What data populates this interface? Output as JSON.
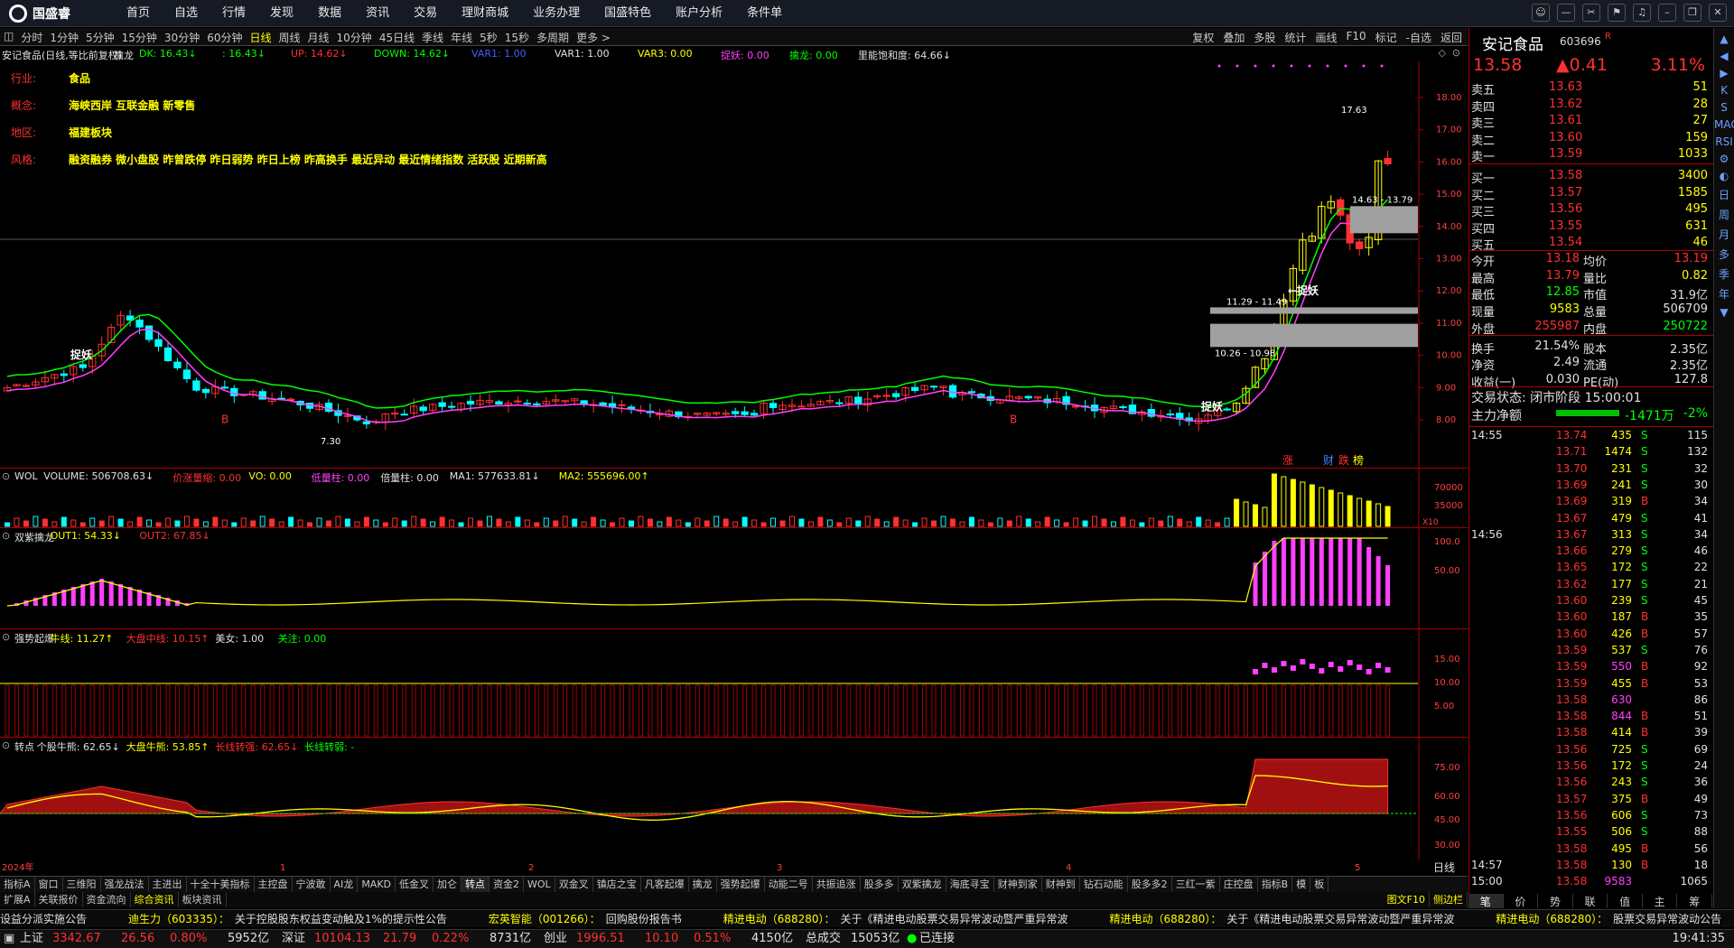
{
  "app": {
    "logo_text": "国盛睿"
  },
  "menu": [
    "首页",
    "自选",
    "行情",
    "发现",
    "数据",
    "资讯",
    "交易",
    "理财商城",
    "业务办理",
    "国盛特色",
    "账户分析",
    "条件单"
  ],
  "window_controls": [
    "chat-icon",
    "min-icon",
    "restore-icon",
    "tools-icon",
    "bell-icon",
    "min2-icon",
    "max-icon",
    "close-icon"
  ],
  "periods": [
    "分时",
    "1分钟",
    "5分钟",
    "15分钟",
    "30分钟",
    "60分钟",
    "日线",
    "周线",
    "月线",
    "10分钟",
    "45日线",
    "季线",
    "年线",
    "5秒",
    "15秒",
    "多周期",
    "更多 >"
  ],
  "period_active": "日线",
  "chart_tools": [
    "复权",
    "叠加",
    "多股",
    "统计",
    "画线",
    "F10",
    "标记",
    "-自选",
    "返回"
  ],
  "title_line": [
    {
      "t": "安记食品(日线,等比前复权)",
      "c": "#e0e0e0"
    },
    {
      "t": "擒龙",
      "c": "#e0e0e0"
    },
    {
      "t": "DK: 16.43↓",
      "c": "#00ff00"
    },
    {
      "t": ": 16.43↓",
      "c": "#00ff00"
    },
    {
      "t": "UP: 14.62↓",
      "c": "#ff3030"
    },
    {
      "t": "DOWN: 14.62↓",
      "c": "#00ff00"
    },
    {
      "t": "VAR1: 1.00",
      "c": "#4060ff"
    },
    {
      "t": "VAR1: 1.00",
      "c": "#e0e0e0"
    },
    {
      "t": "VAR3: 0.00",
      "c": "#ffff00"
    },
    {
      "t": "捉妖: 0.00",
      "c": "#ff40ff"
    },
    {
      "t": "擒龙: 0.00",
      "c": "#00ff00"
    },
    {
      "t": "里能饱和度: 64.66↓",
      "c": "#e0e0e0"
    }
  ],
  "info": [
    {
      "k": "行业:",
      "v": "食品"
    },
    {
      "k": "概念:",
      "v": "海峡西岸 互联金融 新零售"
    },
    {
      "k": "地区:",
      "v": "福建板块"
    },
    {
      "k": "风格:",
      "v": "融资融券 微小盘股 昨曾跌停 昨日弱势 昨日上榜 昨高换手 最近异动 最近情绪指数 活跃股 近期新高"
    }
  ],
  "annotations": {
    "high": "17.63",
    "box1": "14.63 - 13.79",
    "box2": "11.29 - 11.49",
    "box3": "10.26 - 10.98",
    "zhuoyao": "捉妖",
    "zhuoyao_arrow": "←捉妖",
    "low": "7.30",
    "b": "B",
    "marks": [
      "涨",
      "财",
      "跌",
      "榜"
    ]
  },
  "sub_headers": {
    "vol": [
      {
        "t": "WOL",
        "c": "#e0e0e0"
      },
      {
        "t": "VOLUME: 506708.63↓",
        "c": "#e0e0e0"
      },
      {
        "t": "价涨量缩: 0.00",
        "c": "#ff3030"
      },
      {
        "t": "VO: 0.00",
        "c": "#ffff00"
      },
      {
        "t": "低量柱: 0.00",
        "c": "#ff40ff"
      },
      {
        "t": "倍量柱: 0.00",
        "c": "#e0e0e0"
      },
      {
        "t": "MA1: 577633.81↓",
        "c": "#e0e0e0"
      },
      {
        "t": "MA2: 555696.00↑",
        "c": "#ffff00"
      }
    ],
    "sz": [
      {
        "t": "双紫擒龙",
        "c": "#e0e0e0"
      },
      {
        "t": "OUT1: 54.33↓",
        "c": "#ffff00"
      },
      {
        "t": "OUT2: 67.85↓",
        "c": "#ff3030"
      }
    ],
    "qs": [
      {
        "t": "强势起爆",
        "c": "#e0e0e0"
      },
      {
        "t": "牛线: 11.27↑",
        "c": "#ffff00"
      },
      {
        "t": "大盘中线: 10.15↑",
        "c": "#ff3030"
      },
      {
        "t": "美女: 1.00",
        "c": "#e0e0e0"
      },
      {
        "t": "关注: 0.00",
        "c": "#00ff00"
      }
    ],
    "zd": [
      {
        "t": "转点",
        "c": "#e0e0e0"
      },
      {
        "t": "个股牛熊: 62.65↓",
        "c": "#e0e0e0"
      },
      {
        "t": "大盘牛熊: 53.85↑",
        "c": "#ffff00"
      },
      {
        "t": "长线转强: 62.65↓",
        "c": "#ff3030"
      },
      {
        "t": "长线转弱: -",
        "c": "#00ff00"
      }
    ]
  },
  "main_axis": [
    "18.00",
    "17.00",
    "16.00",
    "15.00",
    "14.00",
    "13.00",
    "12.00",
    "11.00",
    "10.00",
    "9.00",
    "8.00"
  ],
  "vol_axis": [
    "70000",
    "35000"
  ],
  "vol_unit": "X10",
  "sz_axis": [
    "100.0",
    "50.00"
  ],
  "qs_axis": [
    "15.00",
    "10.00",
    "5.00"
  ],
  "zd_axis": [
    "75.00",
    "60.00",
    "45.00",
    "30.00"
  ],
  "x_labels": [
    "2024年",
    "1",
    "2",
    "3",
    "4",
    "5"
  ],
  "period_label": "日线",
  "bottom_tabs": [
    "指标A",
    "窗口",
    "三维阳",
    "强龙战法",
    "主进出",
    "十全十美指标",
    "主控盘",
    "宁波敢",
    "AI龙",
    "MAKD",
    "低金叉",
    "加仑",
    "转点",
    "资金2",
    "WOL",
    "双金叉",
    "镇店之宝",
    "凡客起爆",
    "擒龙",
    "强势起爆",
    "动能二号",
    "共振追涨",
    "股多多",
    "双紫擒龙",
    "海底寻宝",
    "财神到家",
    "财神到",
    "钻石动能",
    "股多多2",
    "三红一紫",
    "庄控盘",
    "指标B",
    "模",
    "板"
  ],
  "bottom_active": "转点",
  "sub_tabs": [
    "扩展A",
    "关联报价",
    "资金流向",
    "综合资讯",
    "板块资讯"
  ],
  "sub_tabs_right": [
    "图文F10",
    "侧边栏"
  ],
  "ticker": [
    {
      "a": "",
      "b": "设益分派实施公告"
    },
    {
      "a": "迪生力（603335）：",
      "b": "关于控股股东权益变动触及1%的提示性公告"
    },
    {
      "a": "宏英智能（001266）：",
      "b": "回购股份报告书"
    },
    {
      "a": "精进电动（688280）：",
      "b": "关于《精进电动股票交易异常波动暨严重异常波"
    },
    {
      "a": "精进电动（688280）：",
      "b": "关于《精进电动股票交易异常波动暨严重异常波"
    },
    {
      "a": "精进电动（688280）：",
      "b": "股票交易异常波动公告"
    }
  ],
  "indices": [
    {
      "n": "上证",
      "p": "3342.67",
      "c": "26.56",
      "pct": "0.80%",
      "amt": "5952亿"
    },
    {
      "n": "深证",
      "p": "10104.13",
      "c": "21.79",
      "pct": "0.22%",
      "amt": "8731亿"
    },
    {
      "n": "创业",
      "p": "1996.51",
      "c": "10.10",
      "pct": "0.51%",
      "amt": "4150亿"
    }
  ],
  "total": {
    "label": "总成交",
    "value": "15053亿"
  },
  "conn": "已连接",
  "clock": "19:41:35",
  "stock": {
    "name": "安记食品",
    "code": "603696",
    "mark": "R",
    "price": "13.58",
    "change": "▲0.41",
    "pct": "3.11%"
  },
  "orderbook": [
    {
      "l": "卖五",
      "p": "13.63",
      "v": "51"
    },
    {
      "l": "卖四",
      "p": "13.62",
      "v": "28"
    },
    {
      "l": "卖三",
      "p": "13.61",
      "v": "27"
    },
    {
      "l": "卖二",
      "p": "13.60",
      "v": "159"
    },
    {
      "l": "卖一",
      "p": "13.59",
      "v": "1033"
    },
    {
      "l": "买一",
      "p": "13.58",
      "v": "3400"
    },
    {
      "l": "买二",
      "p": "13.57",
      "v": "1585"
    },
    {
      "l": "买三",
      "p": "13.56",
      "v": "495"
    },
    {
      "l": "买四",
      "p": "13.55",
      "v": "631"
    },
    {
      "l": "买五",
      "p": "13.54",
      "v": "46"
    }
  ],
  "quote": [
    {
      "a": "今开",
      "b": "13.18",
      "c": "均价",
      "d": "13.19"
    },
    {
      "a": "最高",
      "b": "13.79",
      "c": "量比",
      "d": "0.82"
    },
    {
      "a": "最低",
      "b": "12.85",
      "c": "市值",
      "d": "31.9亿"
    },
    {
      "a": "现量",
      "b": "9583",
      "c": "总量",
      "d": "506709"
    },
    {
      "a": "外盘",
      "b": "255987",
      "c": "内盘",
      "d": "250722"
    },
    {
      "a": "换手",
      "b": "21.54%",
      "c": "股本",
      "d": "2.35亿"
    },
    {
      "a": "净资",
      "b": "2.49",
      "c": "流通",
      "d": "2.35亿"
    },
    {
      "a": "收益(一)",
      "b": "0.030",
      "c": "PE(动)",
      "d": "127.8"
    }
  ],
  "trade_state": "交易状态: 闭市阶段 15:00:01",
  "net_flow": {
    "label": "主力净额",
    "value": "-1471万",
    "pct": "-2%"
  },
  "ticks": [
    {
      "t": "14:55",
      "p": "13.74",
      "v": "435",
      "s": "S",
      "n": "115"
    },
    {
      "t": "",
      "p": "13.71",
      "v": "1474",
      "s": "S",
      "n": "132"
    },
    {
      "t": "",
      "p": "13.70",
      "v": "231",
      "s": "S",
      "n": "32"
    },
    {
      "t": "",
      "p": "13.69",
      "v": "241",
      "s": "S",
      "n": "30"
    },
    {
      "t": "",
      "p": "13.69",
      "v": "319",
      "s": "B",
      "n": "34"
    },
    {
      "t": "",
      "p": "13.67",
      "v": "479",
      "s": "S",
      "n": "41"
    },
    {
      "t": "14:56",
      "p": "13.67",
      "v": "313",
      "s": "S",
      "n": "34"
    },
    {
      "t": "",
      "p": "13.66",
      "v": "279",
      "s": "S",
      "n": "46"
    },
    {
      "t": "",
      "p": "13.65",
      "v": "172",
      "s": "S",
      "n": "22"
    },
    {
      "t": "",
      "p": "13.62",
      "v": "177",
      "s": "S",
      "n": "21"
    },
    {
      "t": "",
      "p": "13.60",
      "v": "239",
      "s": "S",
      "n": "45"
    },
    {
      "t": "",
      "p": "13.60",
      "v": "187",
      "s": "B",
      "n": "35"
    },
    {
      "t": "",
      "p": "13.60",
      "v": "426",
      "s": "B",
      "n": "57"
    },
    {
      "t": "",
      "p": "13.59",
      "v": "537",
      "s": "S",
      "n": "76"
    },
    {
      "t": "",
      "p": "13.59",
      "v": "550",
      "s": "B",
      "n": "92"
    },
    {
      "t": "",
      "p": "13.59",
      "v": "455",
      "s": "B",
      "n": "53"
    },
    {
      "t": "",
      "p": "13.58",
      "v": "630",
      "s": "",
      "n": "86"
    },
    {
      "t": "",
      "p": "13.58",
      "v": "844",
      "s": "B",
      "n": "51"
    },
    {
      "t": "",
      "p": "13.58",
      "v": "414",
      "s": "B",
      "n": "39"
    },
    {
      "t": "",
      "p": "13.56",
      "v": "725",
      "s": "S",
      "n": "69"
    },
    {
      "t": "",
      "p": "13.56",
      "v": "172",
      "s": "S",
      "n": "24"
    },
    {
      "t": "",
      "p": "13.56",
      "v": "243",
      "s": "S",
      "n": "36"
    },
    {
      "t": "",
      "p": "13.57",
      "v": "375",
      "s": "B",
      "n": "49"
    },
    {
      "t": "",
      "p": "13.56",
      "v": "606",
      "s": "S",
      "n": "73"
    },
    {
      "t": "",
      "p": "13.55",
      "v": "506",
      "s": "S",
      "n": "88"
    },
    {
      "t": "",
      "p": "13.58",
      "v": "495",
      "s": "B",
      "n": "56"
    },
    {
      "t": "14:57",
      "p": "13.58",
      "v": "130",
      "s": "B",
      "n": "18"
    },
    {
      "t": "15:00",
      "p": "13.58",
      "v": "9583",
      "s": "",
      "n": "1065"
    }
  ],
  "right_tabs": [
    "笔",
    "价",
    "势",
    "联",
    "值",
    "主",
    "筹"
  ],
  "side_tabs": [
    "▲",
    "◀",
    "▶",
    "K",
    "S",
    "MACD",
    "RSI",
    "⚙",
    "◐",
    "日",
    "周",
    "月",
    "多",
    "季",
    "年",
    "▼"
  ],
  "colors": {
    "up": "#ff3030",
    "down": "#00ffff",
    "yellow": "#ffff00",
    "green": "#00ff00",
    "magenta": "#ff40ff"
  },
  "chart_data": {
    "type": "candlestick",
    "ylim": [
      7.3,
      18.9
    ],
    "candles": []
  }
}
